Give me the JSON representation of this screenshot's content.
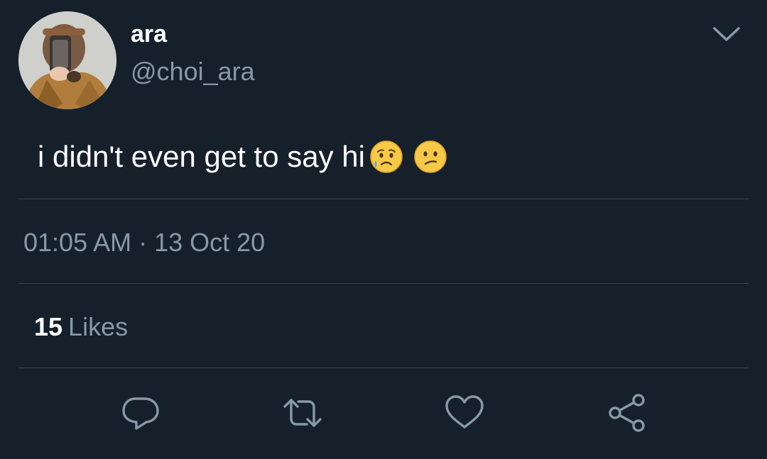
{
  "user": {
    "display_name": "ara",
    "handle": "@choi_ara",
    "avatar_icon": "profile-photo"
  },
  "tweet": {
    "text": "i didn't even get to say hi",
    "emojis": [
      "sad-but-relieved-face-emoji",
      "confused-face-emoji"
    ],
    "timestamp": "01:05 AM · 13 Oct 20"
  },
  "stats": {
    "likes_count": "15",
    "likes_label": "Likes"
  },
  "actions": [
    {
      "name": "reply",
      "icon": "reply-icon"
    },
    {
      "name": "retweet",
      "icon": "retweet-icon"
    },
    {
      "name": "like",
      "icon": "heart-icon"
    },
    {
      "name": "share",
      "icon": "share-icon"
    }
  ],
  "colors": {
    "background": "#15202b",
    "primary_text": "#ffffff",
    "secondary_text": "#8899a6",
    "divider": "#38444d"
  }
}
